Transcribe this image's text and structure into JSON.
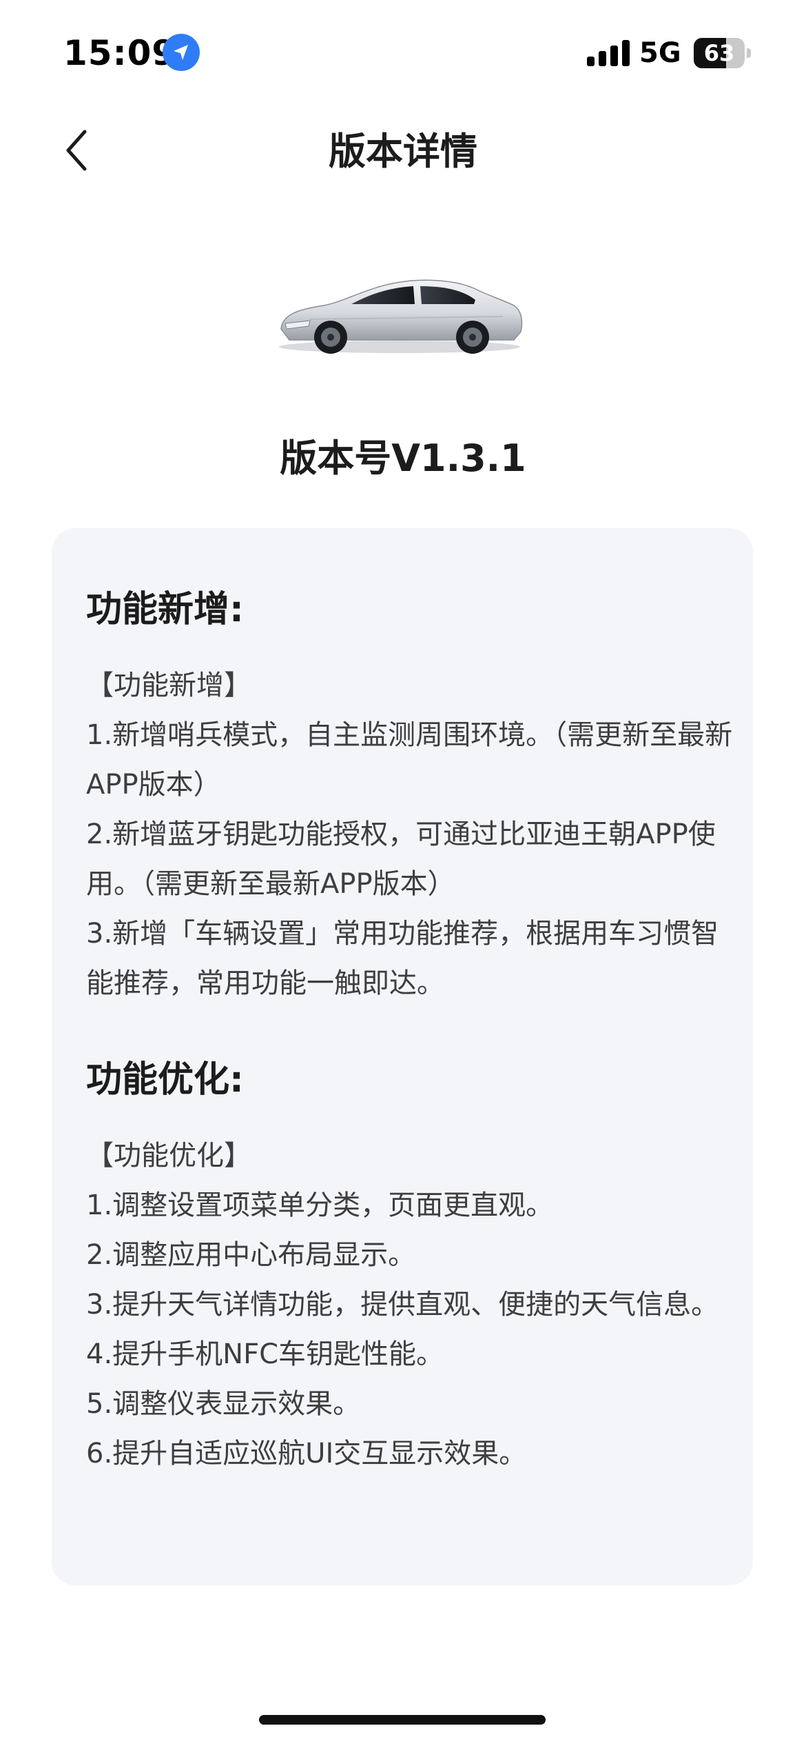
{
  "status_bar": {
    "time": "15:09",
    "network": "5G",
    "battery_level": "63",
    "battery_fraction": 0.63,
    "location_icon": "location-arrow-icon",
    "signal_icon": "cellular-signal-icon"
  },
  "header": {
    "back_icon": "chevron-left-icon",
    "title": "版本详情"
  },
  "vehicle": {
    "image": "car-image"
  },
  "version": {
    "title": "版本号V1.3.1"
  },
  "sections": [
    {
      "heading": "功能新增:",
      "lines": [
        "【功能新增】",
        "1.新增哨兵模式，自主监测周围环境。（需更新至最新APP版本）",
        "2.新增蓝牙钥匙功能授权，可通过比亚迪王朝APP使用。（需更新至最新APP版本）",
        "3.新增「车辆设置」常用功能推荐，根据用车习惯智能推荐，常用功能一触即达。"
      ]
    },
    {
      "heading": "功能优化:",
      "lines": [
        "【功能优化】",
        "1.调整设置项菜单分类，页面更直观。",
        "2.调整应用中心布局显示。",
        "3.提升天气详情功能，提供直观、便捷的天气信息。",
        "4.提升手机NFC车钥匙性能。",
        "5.调整仪表显示效果。",
        "6.提升自适应巡航UI交互显示效果。"
      ]
    }
  ],
  "colors": {
    "accent_blue": "#2f7cf6",
    "card_background": "#f4f5f9",
    "text_primary": "#1c1c1c",
    "text_body": "#3e3e3e"
  }
}
